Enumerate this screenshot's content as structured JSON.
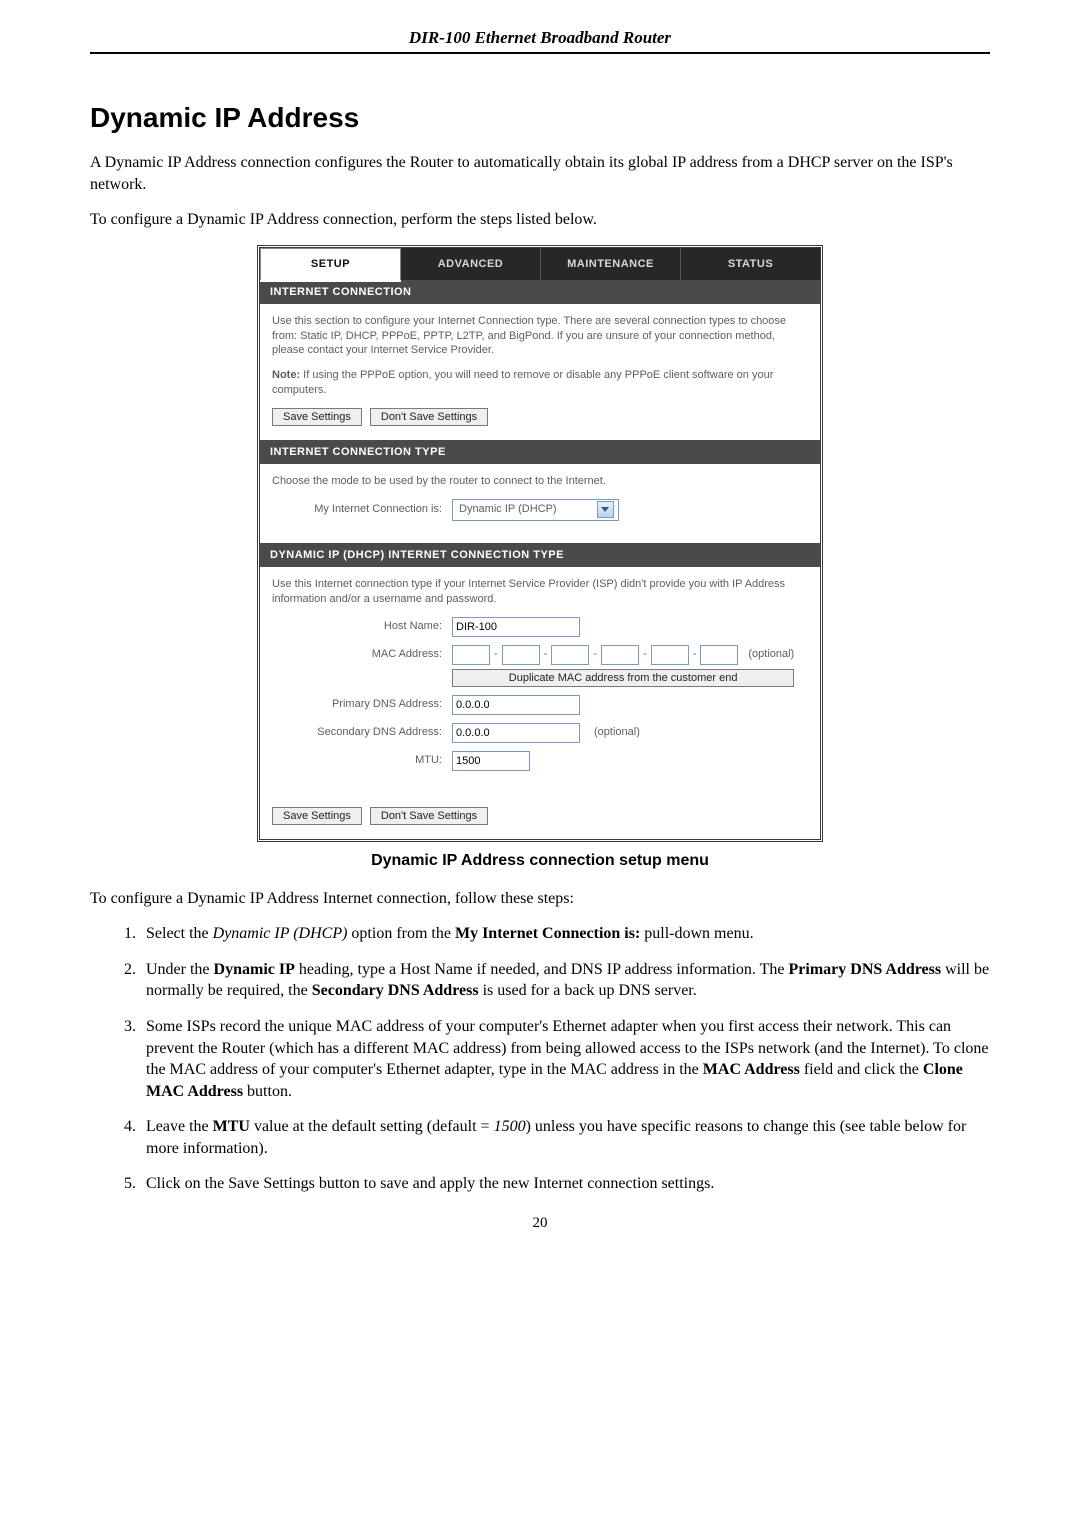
{
  "doc_header": "DIR-100 Ethernet Broadband Router",
  "section_title": "Dynamic IP Address",
  "intro_1": "A Dynamic IP Address connection configures the Router to automatically obtain its global IP address from a DHCP server on the ISP's network.",
  "intro_2": "To configure a Dynamic IP Address connection, perform the steps listed below.",
  "tabs": {
    "setup": "SETUP",
    "advanced": "ADVANCED",
    "maintenance": "MAINTENANCE",
    "status": "STATUS"
  },
  "panel1": {
    "title": "INTERNET CONNECTION",
    "text": "Use this section to configure your Internet Connection type. There are several connection types to choose from: Static IP, DHCP, PPPoE, PPTP, L2TP, and BigPond. If you are unsure of your connection method, please contact your Internet Service Provider.",
    "note_label": "Note:",
    "note_text": " If using the PPPoE option, you will need to remove or disable any PPPoE client software on your computers.",
    "save": "Save Settings",
    "dontsave": "Don't Save Settings"
  },
  "panel2": {
    "title": "INTERNET CONNECTION TYPE",
    "text": "Choose the mode to be used by the router to connect to the Internet.",
    "label": "My Internet Connection is:",
    "select_value": "Dynamic IP (DHCP)"
  },
  "panel3": {
    "title": "DYNAMIC IP (DHCP) INTERNET CONNECTION TYPE",
    "text": "Use this Internet connection type if your Internet Service Provider (ISP) didn't provide you with IP Address information and/or a username and password.",
    "host_label": "Host Name:",
    "host_value": "DIR-100",
    "mac_label": "MAC Address:",
    "mac_optional": "(optional)",
    "mac_dup": "Duplicate MAC address from the customer end",
    "pdns_label": "Primary DNS Address:",
    "pdns_value": "0.0.0.0",
    "sdns_label": "Secondary DNS Address:",
    "sdns_value": "0.0.0.0",
    "sdns_optional": "(optional)",
    "mtu_label": "MTU:",
    "mtu_value": "1500"
  },
  "bottom_buttons": {
    "save": "Save Settings",
    "dontsave": "Don't Save Settings"
  },
  "caption": "Dynamic IP Address connection setup menu",
  "steps_intro": "To configure a Dynamic IP Address Internet connection, follow these steps:",
  "steps": {
    "s1_a": "Select the ",
    "s1_em": "Dynamic IP (DHCP)",
    "s1_b": " option from the ",
    "s1_bold": "My Internet Connection is:",
    "s1_c": " pull-down menu.",
    "s2_a": "Under the ",
    "s2_bold1": "Dynamic IP",
    "s2_b": " heading, type a Host Name if needed, and DNS IP address information. The ",
    "s2_bold2": "Primary DNS Address",
    "s2_c": " will be normally be required, the ",
    "s2_bold3": "Secondary DNS Address",
    "s2_d": " is used for a back up DNS server.",
    "s3_a": "Some ISPs record the unique MAC address of your computer's Ethernet adapter when you first access their network. This can prevent the Router (which has a different MAC address) from being allowed access to the ISPs network (and the Internet). To clone the MAC address of your computer's Ethernet adapter, type in the MAC address in the ",
    "s3_bold1": "MAC Address",
    "s3_b": " field and click the ",
    "s3_bold2": "Clone MAC Address",
    "s3_c": " button.",
    "s4_a": "Leave the ",
    "s4_bold": "MTU",
    "s4_b": " value at the default setting (default = ",
    "s4_em": "1500",
    "s4_c": ") unless you have specific reasons to change this (see table below for more information).",
    "s5": "Click on the Save Settings button to save and apply the new Internet connection settings."
  },
  "page_number": "20"
}
